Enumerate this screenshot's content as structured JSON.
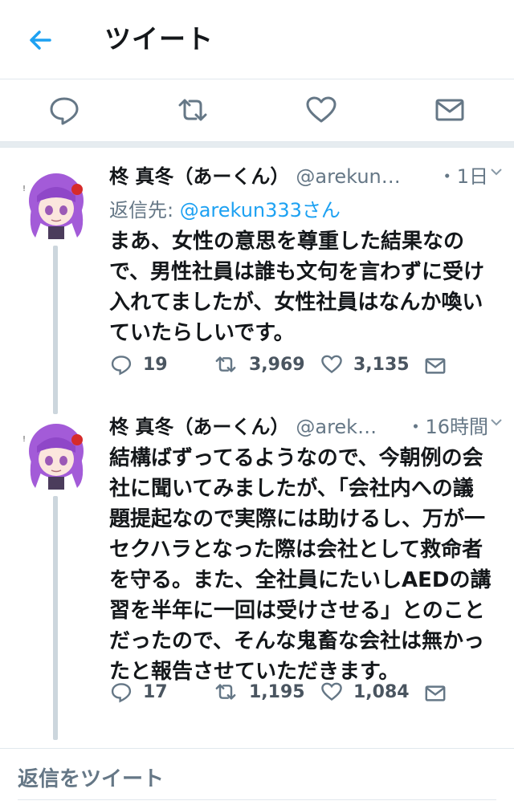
{
  "header": {
    "title": "ツイート"
  },
  "icons": {
    "back": "arrow-left-icon",
    "reply": "reply-icon",
    "retweet": "retweet-icon",
    "like": "heart-icon",
    "dm": "mail-icon"
  },
  "colors": {
    "accent": "#1da1f2",
    "muted": "#657786",
    "divider": "#e1e8ed"
  },
  "tweets": [
    {
      "name": "柊 真冬（あーくん）",
      "handle": "@arekun…",
      "time": "・1日",
      "reply_prefix": "返信先: ",
      "reply_to": "@arekun333さん",
      "lines": [
        "まあ、女性の意思を尊重した結果なの",
        "で、男性社員は誰も文句を言わずに受け",
        "入れてましたが、女性社員はなんか喚い",
        "ていたらしいです。"
      ],
      "replies": "19",
      "retweets": "3,969",
      "likes": "3,135"
    },
    {
      "name": "柊 真冬（あーくん）",
      "handle": "@arek…",
      "time": "・16時間",
      "lines": [
        "結構ばずってるようなので、今朝例の会",
        "社に聞いてみましたが、「会社内への議",
        "題提起なので実際には助けるし、万が一",
        "セクハラとなった際は会社として救命者",
        "を守る。また、全社員にたいしAEDの講",
        "習を半年に一回は受けさせる」とのこと",
        "だったので、そんな鬼畜な会社は無かっ",
        "たと報告させていただきます。"
      ],
      "replies": "17",
      "retweets": "1,195",
      "likes": "1,084"
    }
  ],
  "reply_field": {
    "placeholder": "返信をツイート"
  }
}
